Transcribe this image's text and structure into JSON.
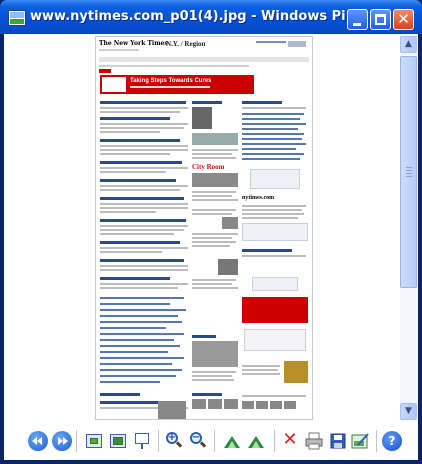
{
  "window": {
    "title": "www.nytimes.com_p01(4).jpg - Windows Pictur...",
    "minimize_label": "",
    "maximize_label": "",
    "close_glyph": "✕"
  },
  "image": {
    "logo_text": "The New York Times",
    "section_title": "N.Y. / Region",
    "ad_headline": "Taking Steps Towards Cures",
    "city_room_label": "City Room",
    "nytimes_brand": "nytimes.com"
  },
  "toolbar": {
    "buttons": [
      {
        "name": "previous-image-button",
        "icon": "previous-icon"
      },
      {
        "name": "next-image-button",
        "icon": "next-icon"
      },
      {
        "name": "best-fit-button",
        "icon": "best-fit-icon"
      },
      {
        "name": "actual-size-button",
        "icon": "actual-size-icon"
      },
      {
        "name": "slideshow-button",
        "icon": "slideshow-icon"
      },
      {
        "name": "zoom-in-button",
        "icon": "zoom-in-icon"
      },
      {
        "name": "zoom-out-button",
        "icon": "zoom-out-icon"
      },
      {
        "name": "rotate-clockwise-button",
        "icon": "rotate-clockwise-icon"
      },
      {
        "name": "rotate-counterclockwise-button",
        "icon": "rotate-counterclockwise-icon"
      },
      {
        "name": "delete-button",
        "icon": "delete-icon"
      },
      {
        "name": "print-button",
        "icon": "print-icon"
      },
      {
        "name": "copy-to-button",
        "icon": "save-icon"
      },
      {
        "name": "open-for-editing-button",
        "icon": "edit-icon"
      },
      {
        "name": "help-button",
        "icon": "help-icon"
      }
    ],
    "zoom_in_sign": "+",
    "zoom_out_sign": "−",
    "delete_glyph": "✕",
    "help_glyph": "?"
  },
  "scrollbar": {
    "up_glyph": "▲",
    "down_glyph": "▼"
  }
}
